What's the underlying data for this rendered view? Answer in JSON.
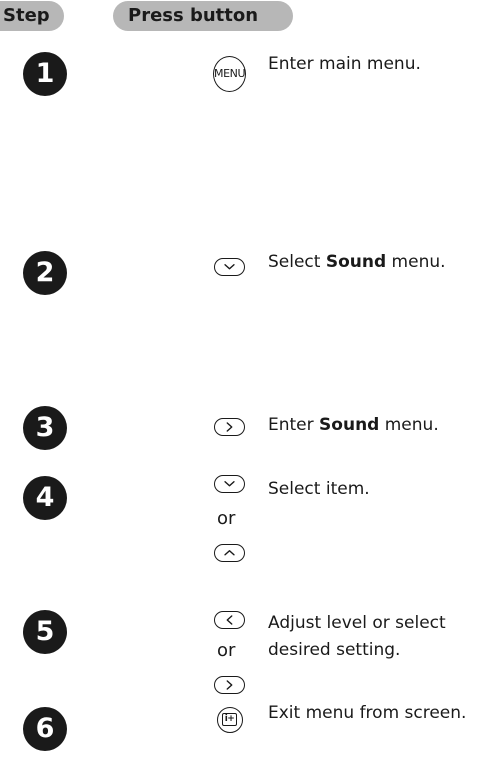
{
  "header": {
    "step_label": "Step",
    "press_label": "Press button"
  },
  "steps": [
    {
      "number": "1",
      "buttons": [
        "menu-button"
      ],
      "button_text": "MENU",
      "description": "Enter main menu."
    },
    {
      "number": "2",
      "buttons": [
        "down-button"
      ],
      "description_before": "Select ",
      "description_bold": "Sound",
      "description_after": " menu."
    },
    {
      "number": "3",
      "buttons": [
        "right-button"
      ],
      "description_before": "Enter ",
      "description_bold": "Sound",
      "description_after": " menu."
    },
    {
      "number": "4",
      "buttons": [
        "down-button",
        "up-button"
      ],
      "connector": "or",
      "description": "Select item."
    },
    {
      "number": "5",
      "buttons": [
        "left-button",
        "right-button"
      ],
      "connector": "or",
      "description_line1": "Adjust level or select",
      "description_line2": "desired setting."
    },
    {
      "number": "6",
      "buttons": [
        "info-button"
      ],
      "button_text": "i+",
      "description": "Exit menu from screen."
    }
  ],
  "icons": {
    "down": "chevron-down-icon",
    "up": "chevron-up-icon",
    "left": "chevron-left-icon",
    "right": "chevron-right-icon",
    "menu": "menu-icon",
    "info": "info-icon"
  },
  "colors": {
    "header_pill": "#b7b7b7",
    "step_circle": "#1a1a1a",
    "text": "#1a1a1a"
  }
}
